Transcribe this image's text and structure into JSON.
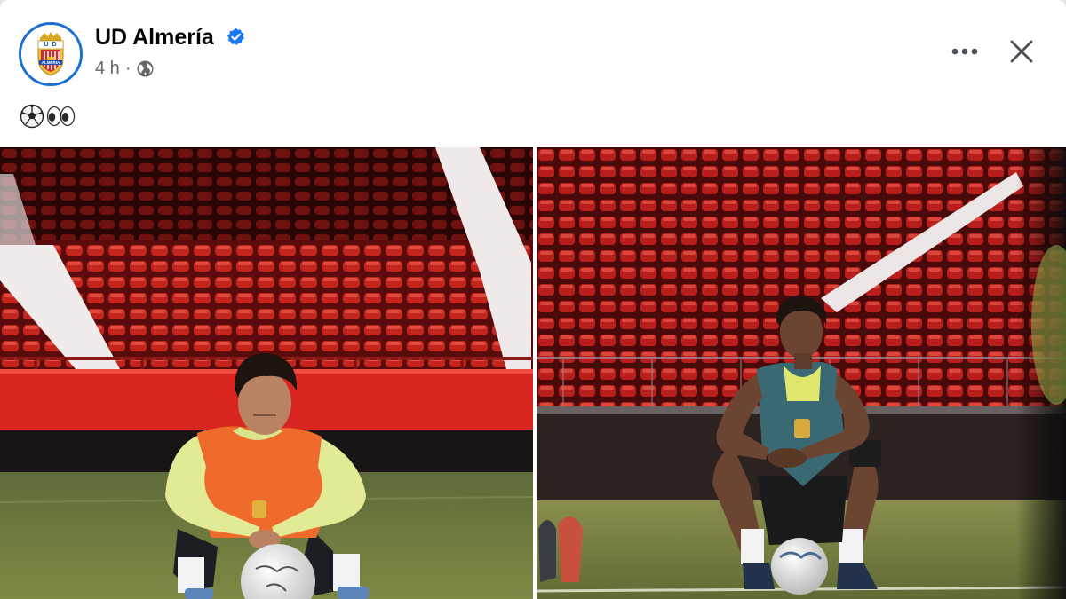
{
  "post": {
    "page_name": "UD Almería",
    "verified": true,
    "time": "4 h",
    "separator": "·",
    "audience_icon": "globe-icon",
    "caption_emojis": [
      "soccer-ball-emoji",
      "eyes-emoji"
    ],
    "actions": {
      "more_icon": "more-options-icon",
      "close_icon": "close-icon"
    },
    "logo": {
      "name": "ud-almeria-crest",
      "letters_top": "U D",
      "letters_bottom": "ALMERIA"
    },
    "photos": [
      {
        "name": "photo-player-orange-bib"
      },
      {
        "name": "photo-player-green-bib"
      }
    ]
  },
  "colors": {
    "accent_blue": "#1877f2",
    "avatar_ring": "#1b6fd0",
    "text_primary": "#050505",
    "text_secondary": "#65676b",
    "stadium_red": "#c8231e",
    "pitch_green": "#6f7a3a"
  }
}
